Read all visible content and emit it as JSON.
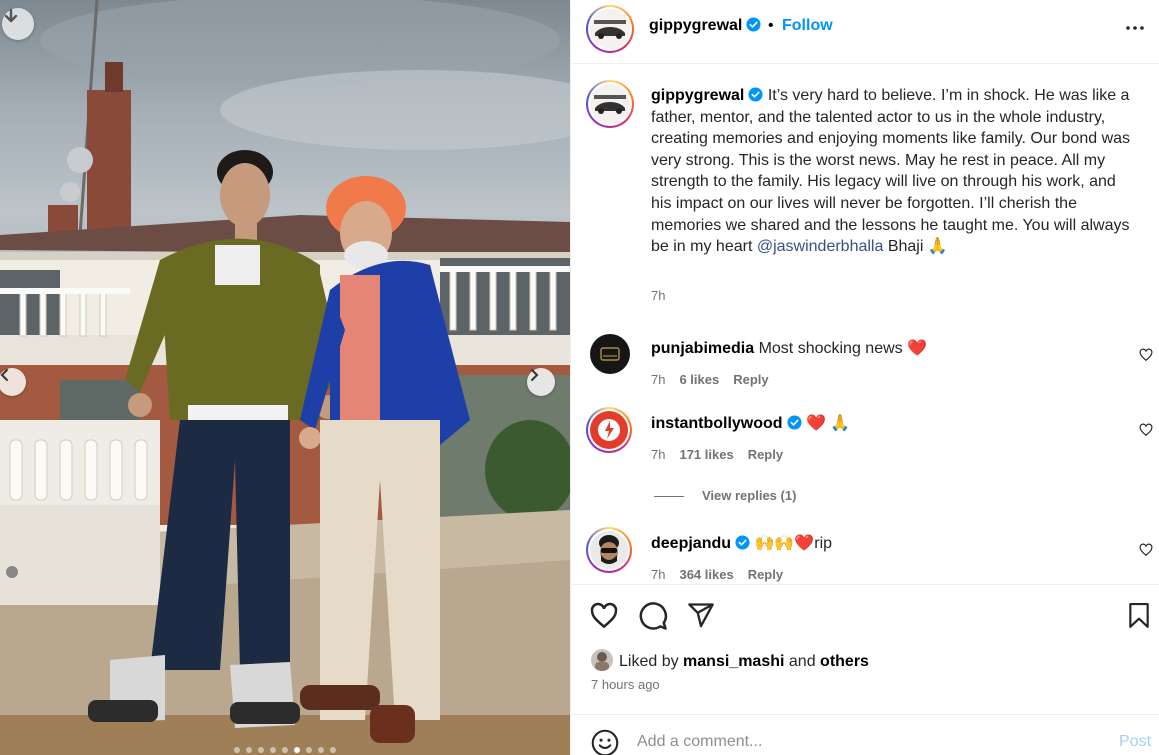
{
  "post": {
    "username": "gippygrewal",
    "follow_label": "Follow",
    "separator": "•",
    "caption_text": "It’s very hard to believe. I’m in shock. He was like a father, mentor, and the talented actor to us in the whole industry, creating memories and enjoying moments like family. Our bond was very strong. This is the worst news. May he rest in peace. All my strength to the family. His legacy will live on through his work, and his impact on our lives will never be forgotten. I’ll cherish the memories we shared and the lessons he taught me. You will always be in my heart",
    "caption_mention": "@jaswinderbhalla",
    "caption_end": "Bhaji 🙏",
    "caption_time": "7h",
    "carousel_dots": 9,
    "carousel_active_index": 5
  },
  "comments": [
    {
      "username": "punjabimedia",
      "verified": false,
      "text": "Most shocking news ❤️",
      "time": "7h",
      "likes": "6 likes",
      "reply": "Reply"
    },
    {
      "username": "instantbollywood",
      "verified": true,
      "text": "❤️ 🙏",
      "time": "7h",
      "likes": "171 likes",
      "reply": "Reply"
    },
    {
      "username": "deepjandu",
      "verified": true,
      "text": "🙌🙌❤️rip",
      "time": "7h",
      "likes": "364 likes",
      "reply": "Reply"
    }
  ],
  "view_replies": "View replies (1)",
  "likes": {
    "prefix": "Liked by",
    "user": "mansi_mashi",
    "and": "and",
    "others": "others"
  },
  "post_time": "7 hours ago",
  "comment_box": {
    "placeholder": "Add a comment...",
    "post_label": "Post"
  },
  "colors": {
    "accent": "#0095f6",
    "verified": "#0095f6",
    "heart_red": "#ed4956",
    "post_disabled": "#a3cff9"
  },
  "icons": [
    "download-icon",
    "chevron-left-icon",
    "chevron-right-icon",
    "more-icon",
    "verified-icon",
    "heart-icon",
    "comment-icon",
    "share-icon",
    "bookmark-icon",
    "emoji-icon"
  ]
}
